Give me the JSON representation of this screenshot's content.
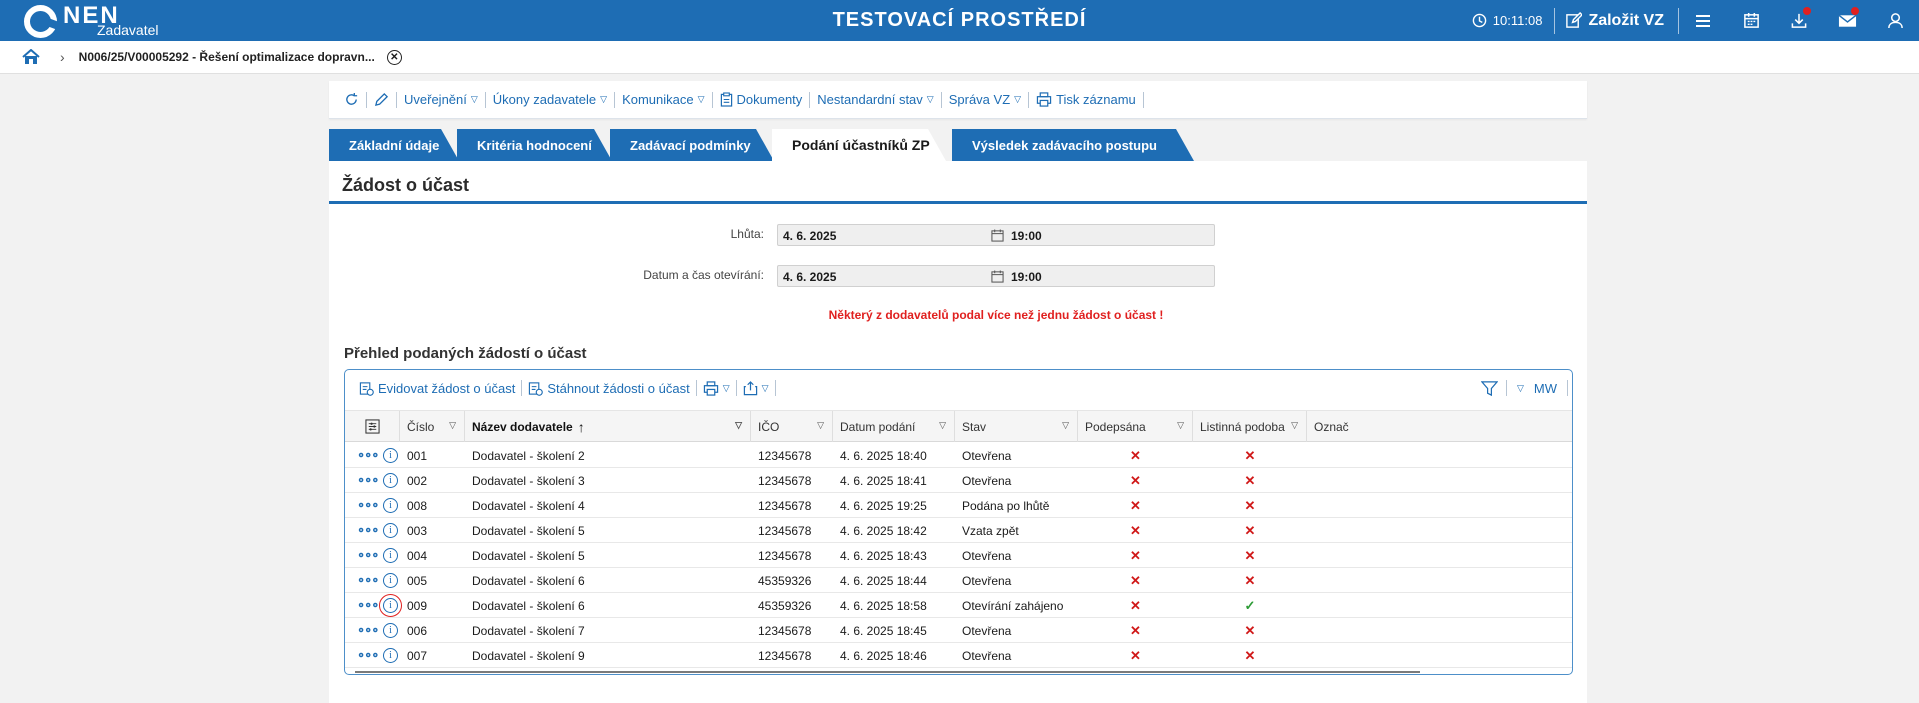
{
  "header": {
    "logo_text": "NEN",
    "logo_sub": "Zadavatel",
    "app_title": "TESTOVACÍ PROSTŘEDÍ",
    "time": "10:11:08",
    "new_vz_label": "Založit VZ"
  },
  "breadcrumb": {
    "item": "N006/25/V00005292 - Řešení optimalizace dopravn..."
  },
  "toolbar": {
    "publish": "Uveřejnění",
    "actions": "Úkony zadavatele",
    "communication": "Komunikace",
    "documents": "Dokumenty",
    "nonstandard": "Nestandardní stav",
    "manage": "Správa VZ",
    "print": "Tisk záznamu"
  },
  "tabs": [
    {
      "label": "Základní údaje"
    },
    {
      "label": "Kritéria hodnocení"
    },
    {
      "label": "Zadávací podmínky"
    },
    {
      "label": "Podání účastníků ZP"
    },
    {
      "label": "Výsledek zadávacího postupu"
    }
  ],
  "section": {
    "title": "Žádost o účast",
    "deadline_label": "Lhůta:",
    "deadline_date": "4. 6. 2025",
    "deadline_time": "19:00",
    "open_label": "Datum a čas otevírání:",
    "open_date": "4. 6. 2025",
    "open_time": "19:00",
    "warning": "Některý z dodavatelů podal více než jednu žádost o účast !",
    "overview_title": "Přehled podaných žádostí o účast"
  },
  "grid": {
    "register_label": "Evidovat žádost o účast",
    "download_label": "Stáhnout žádosti o účast",
    "mw_label": "MW",
    "columns": [
      "Číslo",
      "Název dodavatele",
      "IČO",
      "Datum podání",
      "Stav",
      "Podepsána",
      "Listinná podoba",
      "Označ"
    ],
    "rows": [
      {
        "cislo": "001",
        "nazev": "Dodavatel - školení 2",
        "ico": "12345678",
        "datum": "4. 6. 2025 18:40",
        "stav": "Otevřena",
        "podepsana": "✕",
        "listinna": "✕"
      },
      {
        "cislo": "002",
        "nazev": "Dodavatel - školení 3",
        "ico": "12345678",
        "datum": "4. 6. 2025 18:41",
        "stav": "Otevřena",
        "podepsana": "✕",
        "listinna": "✕"
      },
      {
        "cislo": "008",
        "nazev": "Dodavatel - školení 4",
        "ico": "12345678",
        "datum": "4. 6. 2025 19:25",
        "stav": "Podána po lhůtě",
        "podepsana": "✕",
        "listinna": "✕"
      },
      {
        "cislo": "003",
        "nazev": "Dodavatel - školení 5",
        "ico": "12345678",
        "datum": "4. 6. 2025 18:42",
        "stav": "Vzata zpět",
        "podepsana": "✕",
        "listinna": "✕"
      },
      {
        "cislo": "004",
        "nazev": "Dodavatel - školení 5",
        "ico": "12345678",
        "datum": "4. 6. 2025 18:43",
        "stav": "Otevřena",
        "podepsana": "✕",
        "listinna": "✕"
      },
      {
        "cislo": "005",
        "nazev": "Dodavatel - školení 6",
        "ico": "45359326",
        "datum": "4. 6. 2025 18:44",
        "stav": "Otevřena",
        "podepsana": "✕",
        "listinna": "✕"
      },
      {
        "cislo": "009",
        "nazev": "Dodavatel - školení 6",
        "ico": "45359326",
        "datum": "4. 6. 2025 18:58",
        "stav": "Otevírání zahájeno",
        "podepsana": "✕",
        "listinna": "✓"
      },
      {
        "cislo": "006",
        "nazev": "Dodavatel - školení 7",
        "ico": "12345678",
        "datum": "4. 6. 2025 18:45",
        "stav": "Otevřena",
        "podepsana": "✕",
        "listinna": "✕"
      },
      {
        "cislo": "007",
        "nazev": "Dodavatel - školení 9",
        "ico": "12345678",
        "datum": "4. 6. 2025 18:46",
        "stav": "Otevřena",
        "podepsana": "✕",
        "listinna": "✕"
      }
    ]
  },
  "colors": {
    "primary": "#1e6db4",
    "error": "#e0201f",
    "ok": "#2c9b35"
  }
}
